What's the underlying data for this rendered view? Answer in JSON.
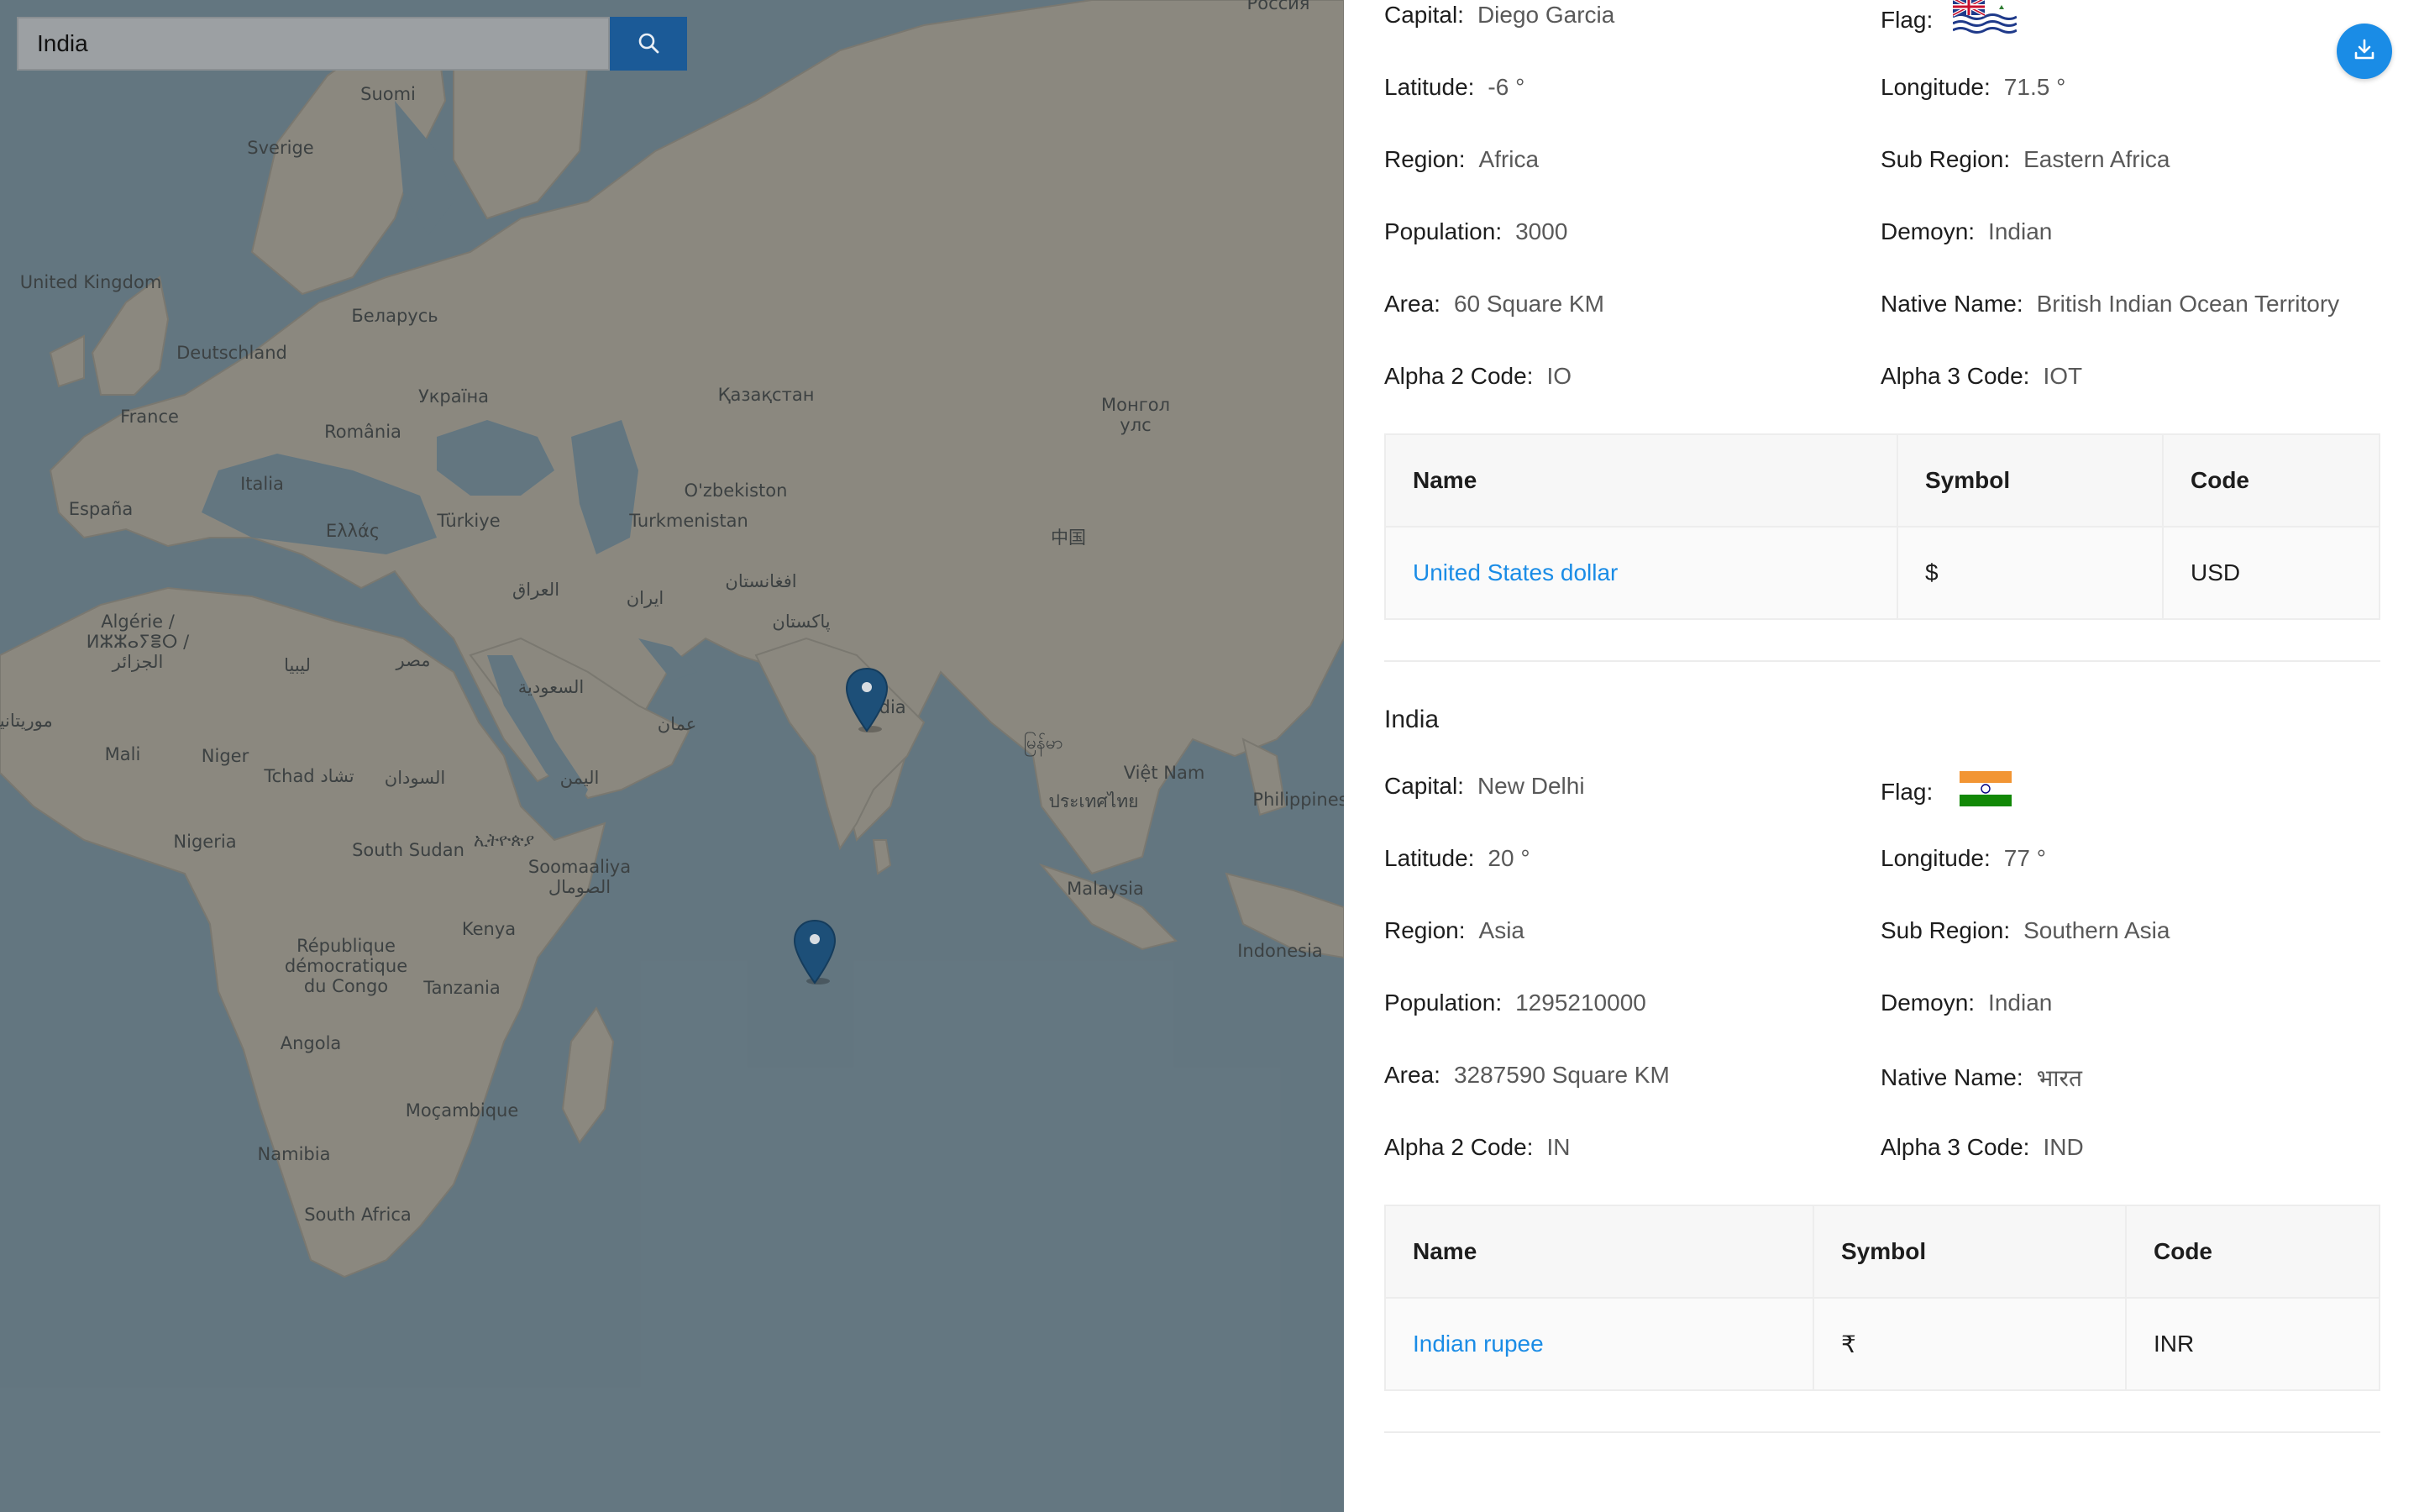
{
  "search": {
    "value": "India"
  },
  "map": {
    "labels": [
      {
        "id": "suomi",
        "text": "Suomi"
      },
      {
        "id": "sverige",
        "text": "Sverige"
      },
      {
        "id": "uk",
        "text": "United Kingdom"
      },
      {
        "id": "belarus",
        "text": "Беларусь"
      },
      {
        "id": "deutschland",
        "text": "Deutschland"
      },
      {
        "id": "ukraina",
        "text": "Україна"
      },
      {
        "id": "france",
        "text": "France"
      },
      {
        "id": "romania",
        "text": "România"
      },
      {
        "id": "kazakhstan",
        "text": "Қазақстан"
      },
      {
        "id": "mongol",
        "text": "Монгол\nулс"
      },
      {
        "id": "espana",
        "text": "España"
      },
      {
        "id": "italia",
        "text": "Italia"
      },
      {
        "id": "ellas",
        "text": "Ελλάς"
      },
      {
        "id": "turkiye",
        "text": "Türkiye"
      },
      {
        "id": "uzbekistan",
        "text": "O'zbekiston"
      },
      {
        "id": "turkmenistan",
        "text": "Turkmenistan"
      },
      {
        "id": "china",
        "text": "中国"
      },
      {
        "id": "afghanistan",
        "text": "افغانستان"
      },
      {
        "id": "iraq",
        "text": "العراق"
      },
      {
        "id": "iran",
        "text": "ایران"
      },
      {
        "id": "pakistan",
        "text": "پاکستان"
      },
      {
        "id": "algerie",
        "text": "Algérie /\nⵍⵣⵣⴰⵢⴻⵔ /\nالجزائر"
      },
      {
        "id": "libya",
        "text": "ليبيا"
      },
      {
        "id": "misr",
        "text": "مصر"
      },
      {
        "id": "saudi",
        "text": "السعودية"
      },
      {
        "id": "oman",
        "text": "عمان"
      },
      {
        "id": "india",
        "text": "ndia"
      },
      {
        "id": "myanmar",
        "text": "မြန်မာ"
      },
      {
        "id": "mauritanie",
        "text": "موريتانيا"
      },
      {
        "id": "mali",
        "text": "Mali"
      },
      {
        "id": "niger",
        "text": "Niger"
      },
      {
        "id": "tchad",
        "text": "Tchad تشاد"
      },
      {
        "id": "sudan",
        "text": "السودان"
      },
      {
        "id": "yemen",
        "text": "اليمن"
      },
      {
        "id": "vietnam",
        "text": "Việt Nam"
      },
      {
        "id": "thailand",
        "text": "ประเทศไทย"
      },
      {
        "id": "philippines",
        "text": "Philippines"
      },
      {
        "id": "nigeria",
        "text": "Nigeria"
      },
      {
        "id": "southsudan",
        "text": "South Sudan"
      },
      {
        "id": "ethiopia",
        "text": "ኢትዮጵያ"
      },
      {
        "id": "somalia",
        "text": "Soomaaliya\nالصومال"
      },
      {
        "id": "malaysia",
        "text": "Malaysia"
      },
      {
        "id": "kenya",
        "text": "Kenya"
      },
      {
        "id": "indonesia",
        "text": "Indonesia"
      },
      {
        "id": "congo",
        "text": "République\ndémocratique\ndu Congo"
      },
      {
        "id": "tanzania",
        "text": "Tanzania"
      },
      {
        "id": "angola",
        "text": "Angola"
      },
      {
        "id": "mozambique",
        "text": "Moçambique"
      },
      {
        "id": "namibia",
        "text": "Namibia"
      },
      {
        "id": "southafrica",
        "text": "South Africa"
      },
      {
        "id": "russia",
        "text": "Россия"
      }
    ]
  },
  "countries": [
    {
      "name": "",
      "capital_label": "Capital:",
      "capital": "Diego Garcia",
      "flag_label": "Flag:",
      "flag": "IO",
      "latitude_label": "Latitude:",
      "latitude": "-6 °",
      "longitude_label": "Longitude:",
      "longitude": "71.5 °",
      "region_label": "Region:",
      "region": "Africa",
      "subregion_label": "Sub Region:",
      "subregion": "Eastern Africa",
      "population_label": "Population:",
      "population": "3000",
      "demonym_label": "Demoyn:",
      "demonym": "Indian",
      "area_label": "Area:",
      "area": "60 Square KM",
      "native_label": "Native Name:",
      "native": "British Indian Ocean Territory",
      "alpha2_label": "Alpha 2 Code:",
      "alpha2": "IO",
      "alpha3_label": "Alpha 3 Code:",
      "alpha3": "IOT",
      "currency_headers": [
        "Name",
        "Symbol",
        "Code"
      ],
      "currency": {
        "name": "United States dollar",
        "symbol": "$",
        "code": "USD"
      }
    },
    {
      "name": "India",
      "capital_label": "Capital:",
      "capital": "New Delhi",
      "flag_label": "Flag:",
      "flag": "IN",
      "latitude_label": "Latitude:",
      "latitude": "20 °",
      "longitude_label": "Longitude:",
      "longitude": "77 °",
      "region_label": "Region:",
      "region": "Asia",
      "subregion_label": "Sub Region:",
      "subregion": "Southern Asia",
      "population_label": "Population:",
      "population": "1295210000",
      "demonym_label": "Demoyn:",
      "demonym": "Indian",
      "area_label": "Area:",
      "area": "3287590 Square KM",
      "native_label": "Native Name:",
      "native": "भारत",
      "alpha2_label": "Alpha 2 Code:",
      "alpha2": "IN",
      "alpha3_label": "Alpha 3 Code:",
      "alpha3": "IND",
      "currency_headers": [
        "Name",
        "Symbol",
        "Code"
      ],
      "currency": {
        "name": "Indian rupee",
        "symbol": "₹",
        "code": "INR"
      }
    }
  ],
  "colors": {
    "accent": "#1a8ce6",
    "search_button": "#1b5a97",
    "water": "#6f8794",
    "land": "#a49d90"
  },
  "icons": {
    "search": "search-icon",
    "download": "download-icon",
    "marker": "map-marker-icon"
  }
}
